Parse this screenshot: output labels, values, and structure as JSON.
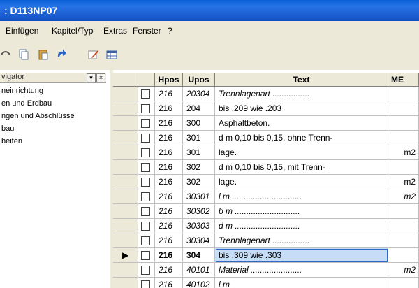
{
  "window": {
    "title": ": D113NP07"
  },
  "menu": [
    "Einfügen",
    "Kapitel/Typ",
    "Extras",
    "Fenster",
    "?"
  ],
  "toolbar": {
    "icons": [
      "undo-icon",
      "copy-icon",
      "paste-icon",
      "redo-icon",
      "edit-icon",
      "table-icon"
    ]
  },
  "navigator": {
    "title": "vigator",
    "items": [
      "neinrichtung",
      "en und Erdbau",
      "ngen und Abschlüsse",
      "bau",
      "beiten"
    ]
  },
  "grid": {
    "headers": [
      "Hpos",
      "Upos",
      "Text",
      "ME"
    ],
    "rows": [
      {
        "hpos": "216",
        "upos": "20304",
        "text": "Trennlagenart ................",
        "me": "",
        "italic": true
      },
      {
        "hpos": "216",
        "upos": "204",
        "text": "bis .209 wie .203",
        "me": "",
        "italic": false
      },
      {
        "hpos": "216",
        "upos": "300",
        "text": "Asphaltbeton.",
        "me": "",
        "italic": false
      },
      {
        "hpos": "216",
        "upos": "301",
        "text": "d m 0,10 bis 0,15, ohne Trenn-",
        "me": "",
        "italic": false
      },
      {
        "hpos": "216",
        "upos": "301",
        "text": "lage.",
        "me": "m2",
        "italic": false
      },
      {
        "hpos": "216",
        "upos": "302",
        "text": "d m 0,10 bis 0,15, mit Trenn-",
        "me": "",
        "italic": false
      },
      {
        "hpos": "216",
        "upos": "302",
        "text": "lage.",
        "me": "m2",
        "italic": false
      },
      {
        "hpos": "216",
        "upos": "30301",
        "text": "l m ..............................",
        "me": "m2",
        "italic": true
      },
      {
        "hpos": "216",
        "upos": "30302",
        "text": "b m ............................",
        "me": "",
        "italic": true
      },
      {
        "hpos": "216",
        "upos": "30303",
        "text": "d m ............................",
        "me": "",
        "italic": true
      },
      {
        "hpos": "216",
        "upos": "30304",
        "text": "Trennlagenart ................",
        "me": "",
        "italic": true
      },
      {
        "hpos": "216",
        "upos": "304",
        "text": "bis .309 wie .303",
        "me": "",
        "italic": false,
        "current": true
      },
      {
        "hpos": "216",
        "upos": "40101",
        "text": "Material ......................",
        "me": "m2",
        "italic": true
      },
      {
        "hpos": "216",
        "upos": "40102",
        "text": "l m",
        "me": "",
        "italic": true
      }
    ]
  }
}
